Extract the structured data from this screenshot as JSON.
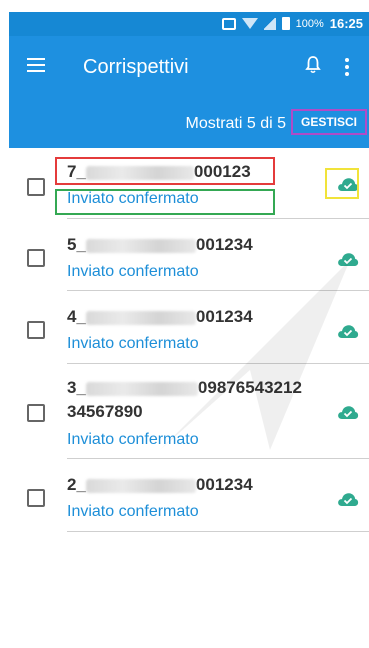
{
  "status_bar": {
    "battery": "100%",
    "time": "16:25"
  },
  "app_bar": {
    "title": "Corrispettivi"
  },
  "toolbar": {
    "shown_text": "Mostrati 5 di 5",
    "manage_label": "GESTISCI"
  },
  "items": [
    {
      "code_prefix": "7_",
      "code_suffix": "000123",
      "status": "Inviato confermato"
    },
    {
      "code_prefix": "5_",
      "code_suffix": "001234",
      "status": "Inviato confermato"
    },
    {
      "code_prefix": "4_",
      "code_suffix": "001234",
      "status": "Inviato confermato"
    },
    {
      "code_prefix": "3_",
      "code_suffix": "09876543212",
      "code_line2": "34567890",
      "status": "Inviato confermato"
    },
    {
      "code_prefix": "2_",
      "code_suffix": "001234",
      "status": "Inviato confermato"
    }
  ],
  "colors": {
    "primary": "#1e90e0",
    "status_text": "#1e8fd8",
    "cloud_icon": "#2faa8f"
  }
}
